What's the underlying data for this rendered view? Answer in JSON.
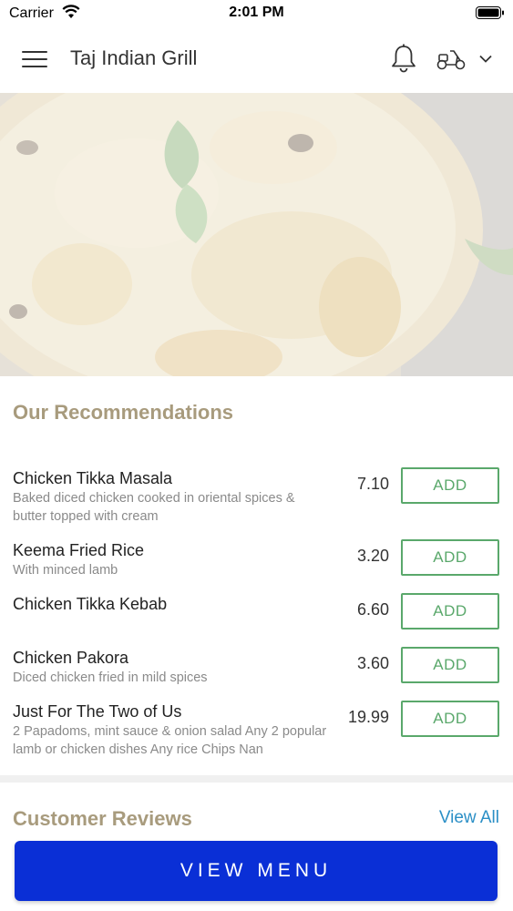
{
  "status": {
    "carrier": "Carrier",
    "time": "2:01 PM",
    "icons": [
      "wifi-icon",
      "battery-icon"
    ]
  },
  "header": {
    "title": "Taj Indian Grill",
    "icons": [
      "menu-icon",
      "bell-icon",
      "scooter-icon",
      "chevron-down-icon"
    ]
  },
  "hero": {
    "image": "biryani-dish",
    "overlay_color": "#ffffff"
  },
  "recommendations": {
    "title": "Our Recommendations",
    "add_label": "ADD",
    "items": [
      {
        "name": "Chicken Tikka Masala",
        "description": "Baked diced chicken cooked in oriental spices & butter topped with cream",
        "price": "7.10"
      },
      {
        "name": "Keema Fried Rice",
        "description": "With minced lamb",
        "price": "3.20"
      },
      {
        "name": "Chicken Tikka Kebab",
        "description": "",
        "price": "6.60"
      },
      {
        "name": "Chicken Pakora",
        "description": "Diced chicken fried in mild spices",
        "price": "3.60"
      },
      {
        "name": "Just For The Two of Us",
        "description": "2 Papadoms, mint sauce & onion salad Any 2 popular lamb or chicken dishes Any rice Chips Nan",
        "price": "19.99"
      }
    ]
  },
  "reviews": {
    "title": "Customer Reviews",
    "view_all": "View All"
  },
  "footer": {
    "view_menu": "VIEW MENU"
  },
  "colors": {
    "accent_title": "#a89b7d",
    "add_button": "#5aa86b",
    "link": "#2b8fc6",
    "primary_button": "#0a2fd6"
  }
}
